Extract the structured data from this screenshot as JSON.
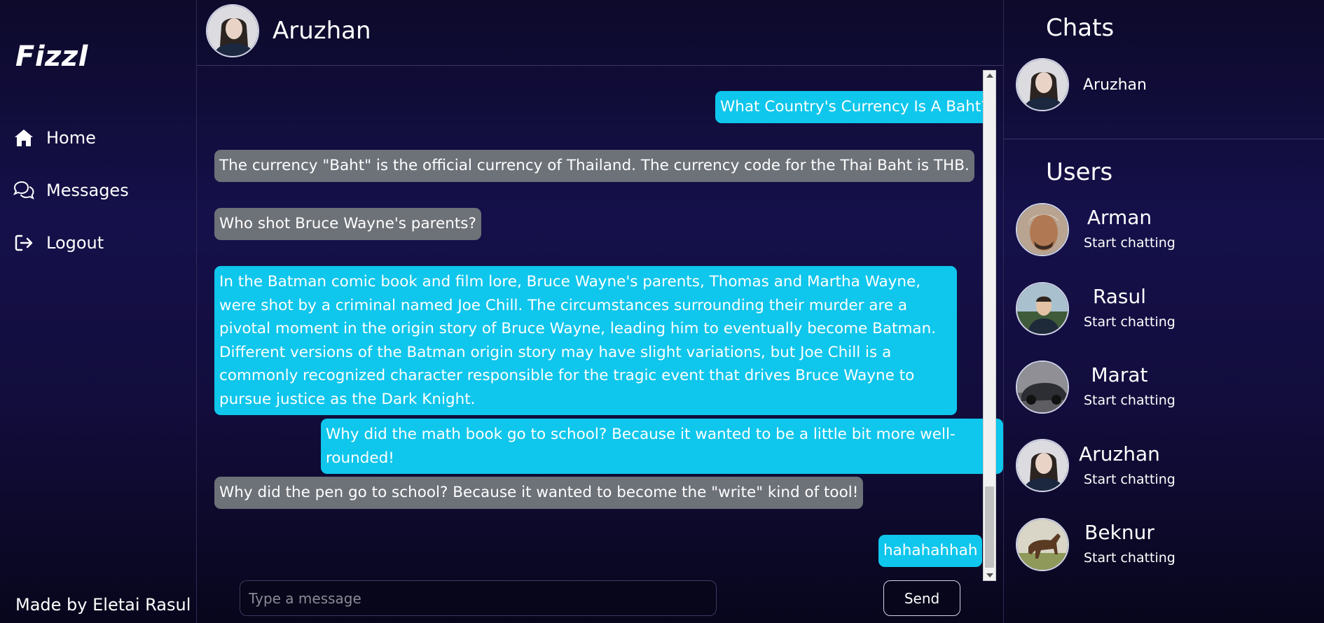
{
  "app": {
    "logo": "Fizzl",
    "footer": "Made by Eletai Rasul"
  },
  "nav": [
    {
      "label": "Home",
      "icon": "home-icon"
    },
    {
      "label": "Messages",
      "icon": "chat-bubbles-icon"
    },
    {
      "label": "Logout",
      "icon": "logout-icon"
    }
  ],
  "chat": {
    "contact_name": "Aruzhan",
    "messages": [
      {
        "from": "me",
        "text": "What Country's Currency Is A Baht?"
      },
      {
        "from": "bot",
        "text": "The currency \"Baht\" is the official currency of Thailand. The currency code for the Thai Baht is THB."
      },
      {
        "from": "bot",
        "text": "Who shot Bruce Wayne's parents?"
      },
      {
        "from": "me",
        "text": "In the Batman comic book and film lore, Bruce Wayne's parents, Thomas and Martha Wayne, were shot by a criminal named Joe Chill. The circumstances surrounding their murder are a pivotal moment in the origin story of Bruce Wayne, leading him to eventually become Batman. Different versions of the Batman origin story may have slight variations, but Joe Chill is a commonly recognized character responsible for the tragic event that drives Bruce Wayne to pursue justice as the Dark Knight."
      },
      {
        "from": "me",
        "text": "Why did the math book go to school? Because it wanted to be a little bit more well-rounded!"
      },
      {
        "from": "bot",
        "text": "Why did the pen go to school? Because it wanted to become the \"write\" kind of tool!"
      },
      {
        "from": "me",
        "text": "hahahahhah"
      }
    ],
    "input_placeholder": "Type a message",
    "input_value": "",
    "send_label": "Send"
  },
  "sidebar_right": {
    "chats_title": "Chats",
    "chats": [
      {
        "name": "Aruzhan"
      }
    ],
    "users_title": "Users",
    "users": [
      {
        "name": "Arman",
        "status": "Start chatting"
      },
      {
        "name": "Rasul",
        "status": "Start chatting"
      },
      {
        "name": "Marat",
        "status": "Start chatting"
      },
      {
        "name": "Aruzhan",
        "status": "Start chatting"
      },
      {
        "name": "Beknur",
        "status": "Start chatting"
      }
    ]
  },
  "colors": {
    "sent_bubble": "#0fc6ec",
    "received_bubble": "#6d7178",
    "background": "#120d3c"
  }
}
